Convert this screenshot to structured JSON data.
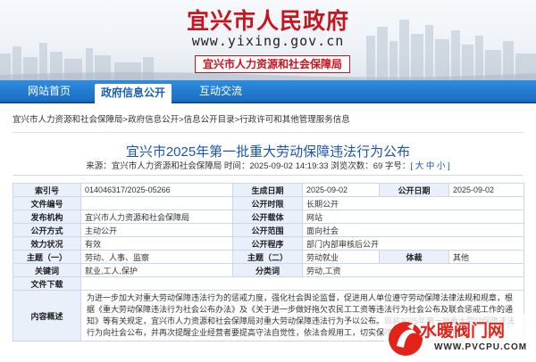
{
  "header": {
    "site_title": "宜兴市人民政府",
    "site_url": "www.yixing.gov.cn",
    "dept_name": "宜兴市人力资源和社会保障局"
  },
  "nav": {
    "items": [
      {
        "label": "网站首页"
      },
      {
        "label": "政府信息公开"
      },
      {
        "label": "互动交流"
      }
    ],
    "active_index": 1
  },
  "breadcrumb": [
    "宜兴市人力资源和社会保障局",
    "政府信息公开",
    "信息公开目录",
    "行政许可和其他管理服务信息"
  ],
  "breadcrumb_sep": ">",
  "article": {
    "title": "宜兴市2025年第一批重大劳动保障违法行为公布",
    "meta_prefix": "来源：宜兴市人力资源和社会保障局 时间：2025-09-02 14:19:33 浏览次数：69 字号：",
    "font_size_label": "[ 大 中 小 ]"
  },
  "info": {
    "index_no_label": "索引号",
    "index_no": "014046317/2025-05266",
    "gen_date_label": "生成日期",
    "gen_date": "2025-09-02",
    "pub_date_label": "公开日期",
    "pub_date": "2025-09-02",
    "doc_no_label": "文件编号",
    "doc_no": "",
    "pub_time_limit_label": "公开时限",
    "pub_time_limit": "长期公开",
    "issuer_label": "发布机构",
    "issuer": "宜兴市人力资源和社会保障局",
    "pub_channel_label": "公开载体",
    "pub_channel": "网站",
    "pub_method_label": "公开方式",
    "pub_method": "主动公开",
    "pub_scope_label": "公开范围",
    "pub_scope": "面向社会",
    "validity_label": "效力状况",
    "validity": "有效",
    "pub_process_label": "公开程序",
    "pub_process": "部门内部审核后公开",
    "topic1_label": "主题（一）",
    "topic1": "劳动、人事、监察",
    "topic2_label": "主题（二）",
    "topic2": "劳动就业",
    "genre_label": "体裁",
    "genre": "其他",
    "keywords_label": "关键词",
    "keywords": "就业,工人,保护",
    "category_label": "分类词",
    "category": "劳动,工资",
    "doc_download_label": "文件下载",
    "doc_download": "",
    "summary_label": "内容概述",
    "summary": "为进一步加大对重大劳动保障违法行为的惩戒力度，强化社会舆论监督，促进用人单位遵守劳动保障法律法规和规章，根据《重大劳动保障违法行为社会公布办法》及《关于进一步做好拖欠农民工工资等违法行为社会公布及联合惩戒工作的通知》等有关规定，宜兴市人力资源和社会保障局对重大劳动保障违法行为予以公布。现将2025年第一批重大劳动保障违法行为向社会公布，并再次提醒企业经营者要提高守法自觉性，依法合规用工，切实保障劳动者的合法权益。"
  },
  "watermark": {
    "text": "水暖阀门网",
    "url": "WWW.PVCPU.COM"
  },
  "colors": {
    "brand_red": "#c8141d",
    "nav_blue": "#1a6cc2",
    "title_blue": "#1a55b0",
    "table_key_bg": "#e9f0fa"
  }
}
